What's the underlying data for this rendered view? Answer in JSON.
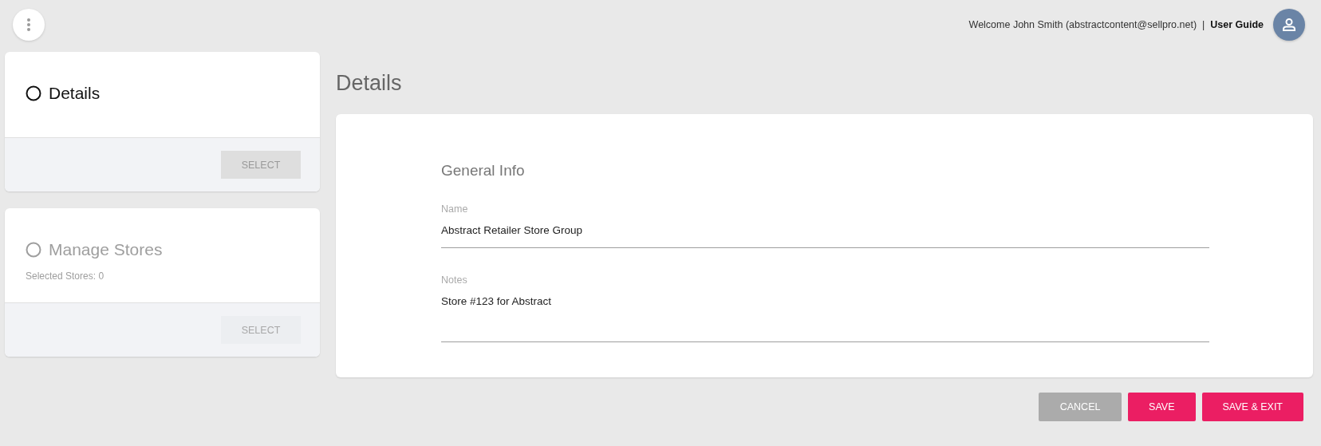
{
  "header": {
    "welcome": "Welcome John Smith (abstractcontent@sellpro.net)",
    "separator": "|",
    "user_guide": "User Guide"
  },
  "steps": [
    {
      "title": "Details",
      "disabled": false,
      "button": "SELECT"
    },
    {
      "title": "Manage Stores",
      "disabled": true,
      "subtitle": "Selected Stores: 0",
      "button": "SELECT"
    }
  ],
  "page_title": "Details",
  "form": {
    "section": "General Info",
    "fields": [
      {
        "label": "Name",
        "value": "Abstract Retailer Store Group",
        "kind": "text"
      },
      {
        "label": "Notes",
        "value": "Store #123 for Abstract",
        "kind": "textarea"
      }
    ]
  },
  "actions": [
    {
      "label": "CANCEL",
      "kind": "secondary"
    },
    {
      "label": "SAVE",
      "kind": "primary"
    },
    {
      "label": "SAVE & EXIT",
      "kind": "primary"
    }
  ]
}
